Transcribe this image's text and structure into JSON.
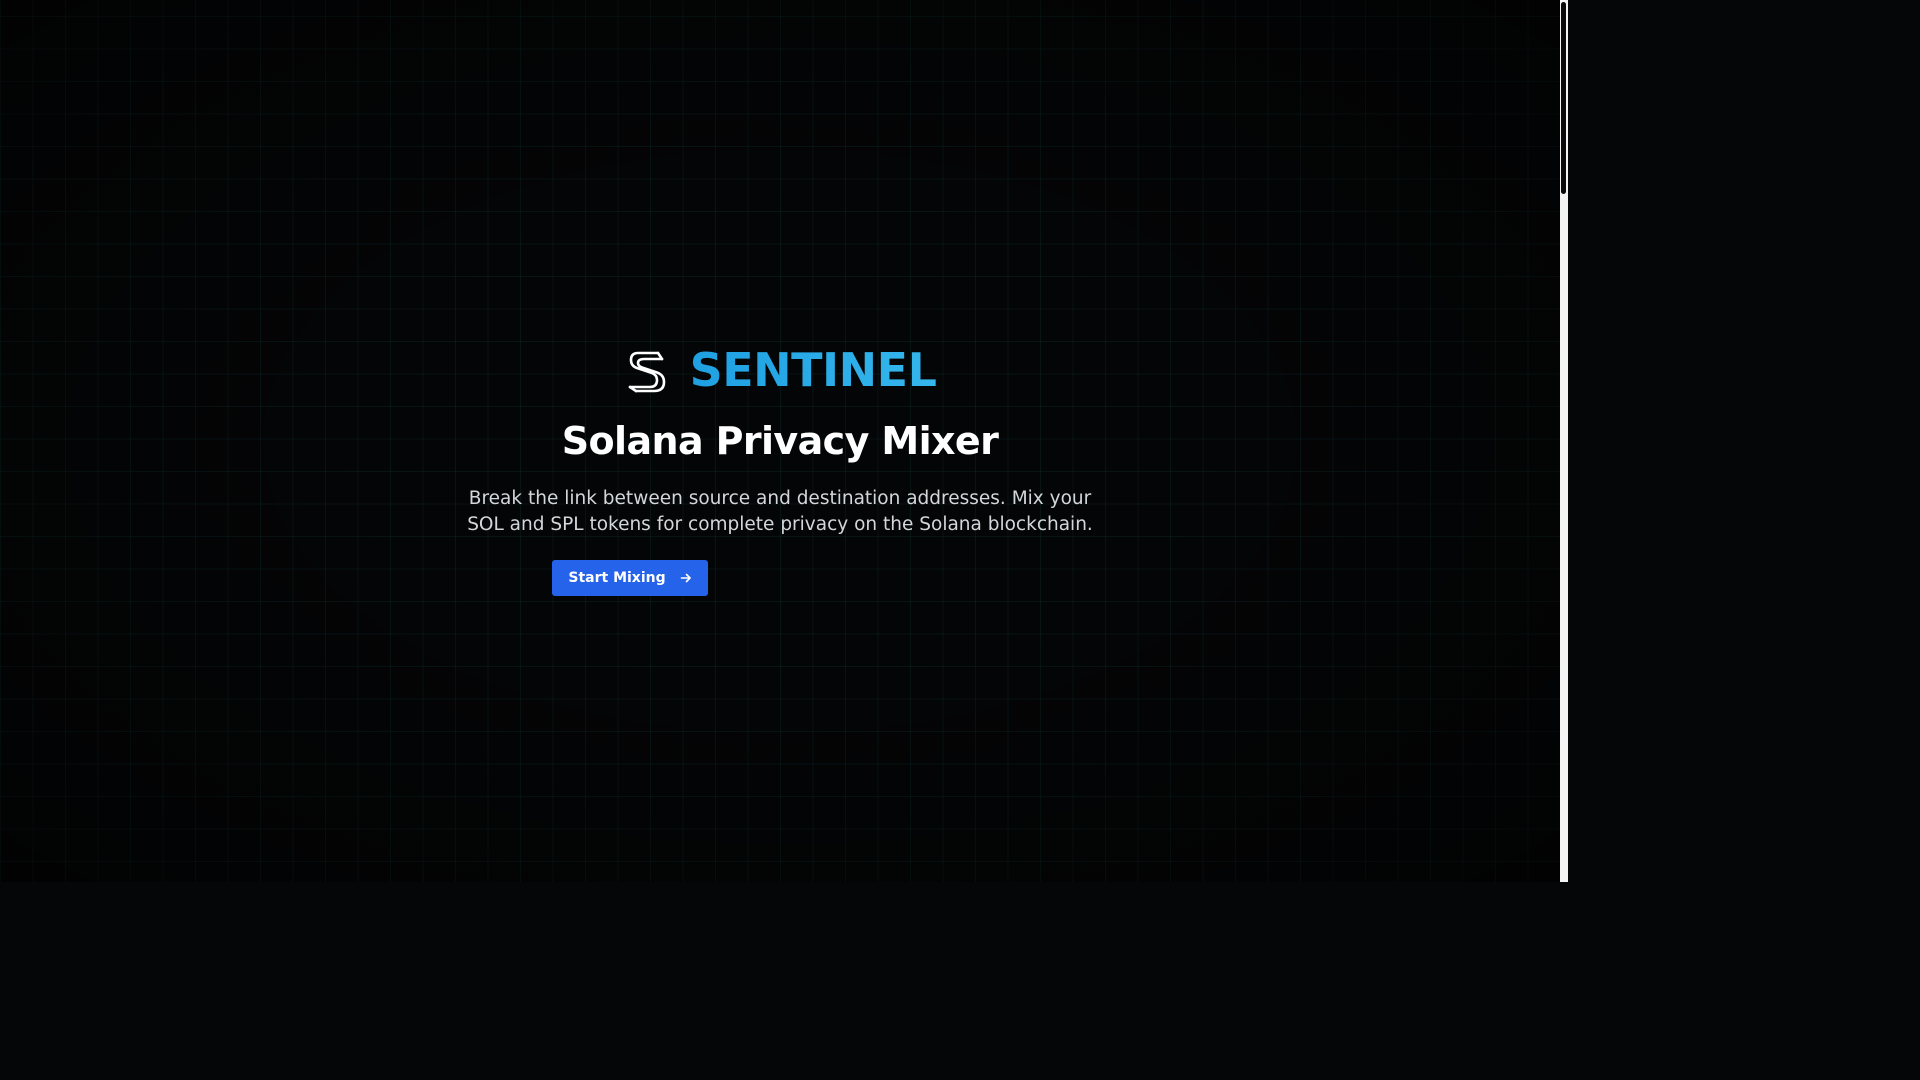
{
  "brand": {
    "name": "SENTINEL",
    "logo_icon": "sentinel-s-logo-icon",
    "name_color": "#27a9e6"
  },
  "hero": {
    "title": "Solana Privacy Mixer",
    "subtitle": "Break the link between source and destination addresses. Mix your SOL and SPL tokens for complete privacy on the Solana blockchain."
  },
  "cta": {
    "label": "Start Mixing",
    "icon": "arrow-right-icon",
    "color": "#2563eb"
  },
  "theme": {
    "background": "#050607",
    "grid_line": "#144646",
    "text": "#ffffff",
    "muted_text": "#d3d6db"
  }
}
